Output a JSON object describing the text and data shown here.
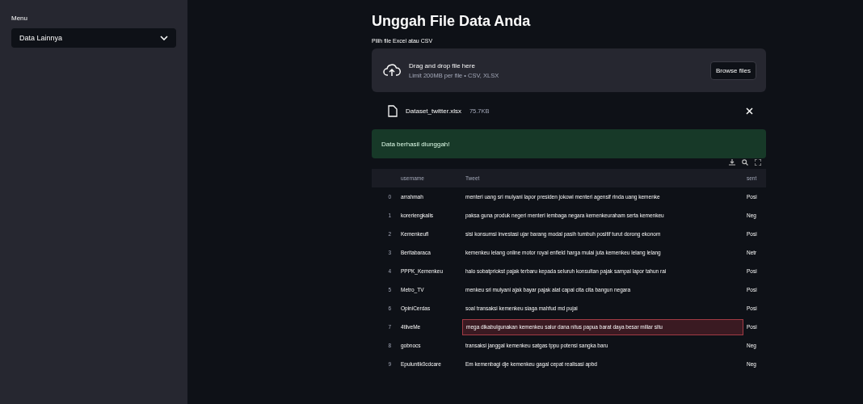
{
  "sidebar": {
    "label": "Menu",
    "select": {
      "value": "Data Lainnya"
    }
  },
  "main": {
    "title": "Unggah File Data Anda",
    "uploader_label": "Pilih file Excel atau CSV",
    "dropzone": {
      "text": "Drag and drop file here",
      "hint": "Limit 200MB per file • CSV, XLSX",
      "button": "Browse files"
    },
    "file": {
      "name": "Dataset_twitter.xlsx",
      "size": "75.7KB"
    },
    "alert": {
      "kind": "success",
      "text": "Data berhasil diunggah!"
    },
    "table": {
      "columns": [
        "",
        "username",
        "Tweet",
        "sent"
      ],
      "rows": [
        {
          "index": "0",
          "username": "arrahmah",
          "tweet": "menteri uang sri mulyani lapor presiden jokowi menteri agensif rinda uang kemenke",
          "sentiment": "Posi",
          "selected": false
        },
        {
          "index": "1",
          "username": "koreriengkalis",
          "tweet": "paksa guna produk negeri menteri lembaga negara kemenkeuraham serta kemenkeu",
          "sentiment": "Neg",
          "selected": false
        },
        {
          "index": "2",
          "username": "Kemenkeufl",
          "tweet": "sisi konsumsi investasi ujar barang modal pasih tumbuh positif turut dorong ekonom",
          "sentiment": "Posi",
          "selected": false
        },
        {
          "index": "3",
          "username": "Beritabaraca",
          "tweet": "kemenkeu lelang online motor royal enfield harga mulai juta kemenkeu lelang lelang",
          "sentiment": "Netr",
          "selected": false
        },
        {
          "index": "4",
          "username": "PPPK_Kemenkeu",
          "tweet": "halo sobatpriokst pajak terbaru kepada seluruh konsultan pajak sampai lapor tahun rai",
          "sentiment": "Posi",
          "selected": false
        },
        {
          "index": "5",
          "username": "Metro_TV",
          "tweet": "menkeu sri mulyani ajak bayar pajak alat capai cita cita bangun negara",
          "sentiment": "Posi",
          "selected": false
        },
        {
          "index": "6",
          "username": "OpiniCerdas",
          "tweet": "soal transaksi kemenkeu siaga mahfud md pujai",
          "sentiment": "Posi",
          "selected": false
        },
        {
          "index": "7",
          "username": "4tliveMe",
          "tweet": "mega dikabulgunakan kemenkeu salur dana nitus papua barat daya besar miliar situ",
          "sentiment": "Posi",
          "selected": true
        },
        {
          "index": "8",
          "username": "gobnocs",
          "tweet": "transaksi janggal kemenkeu satgas tppu potensi sangka baru",
          "sentiment": "Neg",
          "selected": false
        },
        {
          "index": "9",
          "username": "Epuluntik0cdcare",
          "tweet": "Em kemenbagi dje kemenkeu gagal cepat realisasi apbd",
          "sentiment": "Neg",
          "selected": false
        }
      ]
    }
  }
}
